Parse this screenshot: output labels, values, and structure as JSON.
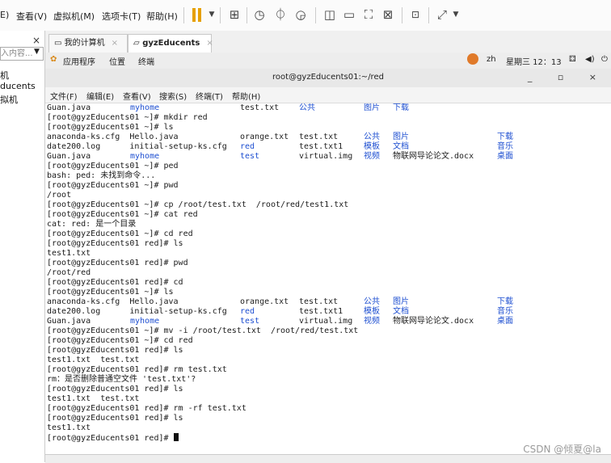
{
  "menubar": {
    "items": [
      "E)",
      "查看(V)",
      "虚拟机(M)",
      "选项卡(T)",
      "帮助(H)"
    ]
  },
  "library": {
    "close": "×",
    "search_placeholder": "入内容...",
    "items": [
      "机",
      "ducents",
      "拟机"
    ]
  },
  "tabs": [
    {
      "label": "我的计算机",
      "close": "×"
    },
    {
      "label": "gyzEducents",
      "close": "×"
    }
  ],
  "gnome": {
    "apps": "应用程序",
    "places": "位置",
    "terminal": "终端",
    "lang": "zh",
    "clock": "星期三 12：13"
  },
  "terminal": {
    "title": "root@gyzEducents01:~/red",
    "controls": "_ ▫ ×",
    "menu": [
      "文件(F)",
      "编辑(E)",
      "查看(V)",
      "搜索(S)",
      "终端(T)",
      "帮助(H)"
    ],
    "lines": [
      "Guan.java",
      "[root@gyzEducents01 ~]# mkdir red",
      "[root@gyzEducents01 ~]# ls",
      "anaconda-ks.cfg  Hello.java",
      "date200.log      initial-setup-ks.cfg",
      "Guan.java",
      "[root@gyzEducents01 ~]# ped",
      "bash: ped: 未找到命令...",
      "[root@gyzEducents01 ~]# pwd",
      "/root",
      "[root@gyzEducents01 ~]# cp /root/test.txt  /root/red/test1.txt",
      "[root@gyzEducents01 ~]# cat red",
      "cat: red: 是一个目录",
      "[root@gyzEducents01 ~]# cd red",
      "[root@gyzEducents01 red]# ls",
      "test1.txt",
      "[root@gyzEducents01 red]# pwd",
      "/root/red",
      "[root@gyzEducents01 red]# cd",
      "[root@gyzEducents01 ~]# ls",
      "anaconda-ks.cfg  Hello.java",
      "date200.log      initial-setup-ks.cfg",
      "Guan.java",
      "[root@gyzEducents01 ~]# mv -i /root/test.txt  /root/red/test.txt",
      "[root@gyzEducents01 ~]# cd red",
      "[root@gyzEducents01 red]# ls",
      "test1.txt  test.txt",
      "[root@gyzEducents01 red]# rm test.txt",
      "rm：是否删除普通空文件 'test.txt'?",
      "[root@gyzEducents01 red]# ls",
      "test1.txt  test.txt",
      "[root@gyzEducents01 red]# rm -rf test.txt",
      "[root@gyzEducents01 red]# ls",
      "test1.txt",
      "[root@gyzEducents01 red]# "
    ],
    "cols": {
      "myhome": "myhome",
      "red": "red",
      "test": "test",
      "orange": "orange.txt",
      "test_txt": "test.txt",
      "test1_txt": "test.txt1",
      "virtual": "virtual.img",
      "gong": "公共",
      "moban": "模板",
      "shipin": "视频",
      "tupian": "图片",
      "wendang": "文档",
      "wulian": "物联网导论论文.docx",
      "xiazai": "下载",
      "yinyue": "音乐",
      "zhuomian": "桌面"
    }
  },
  "watermark": "CSDN @倾夏@la",
  "colors": {
    "link_blue": "#1e4fd1",
    "pause_orange": "#e6a000"
  }
}
